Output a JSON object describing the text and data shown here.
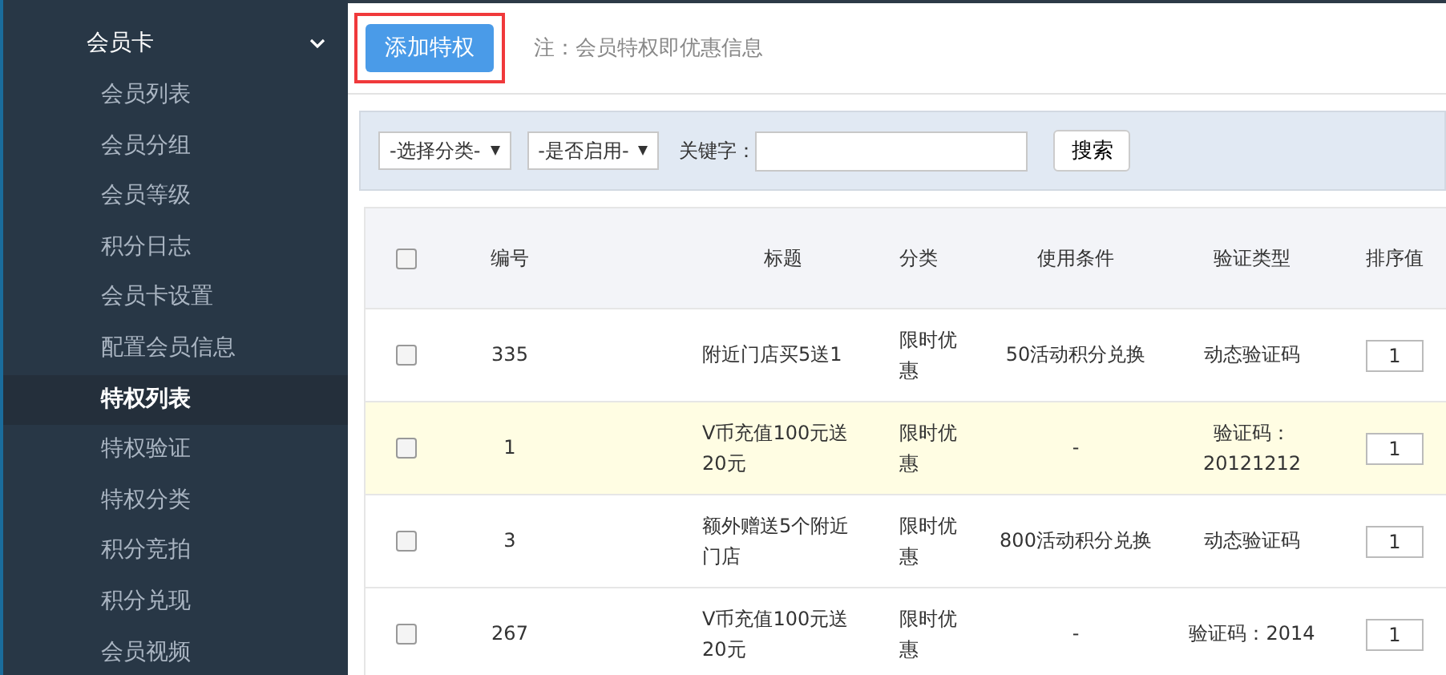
{
  "sidebar": {
    "group": {
      "label": "会员卡",
      "expanded": true
    },
    "items": [
      {
        "label": "会员列表",
        "selected": false
      },
      {
        "label": "会员分组",
        "selected": false
      },
      {
        "label": "会员等级",
        "selected": false
      },
      {
        "label": "积分日志",
        "selected": false
      },
      {
        "label": "会员卡设置",
        "selected": false
      },
      {
        "label": "配置会员信息",
        "selected": false
      },
      {
        "label": "特权列表",
        "selected": true
      },
      {
        "label": "特权验证",
        "selected": false
      },
      {
        "label": "特权分类",
        "selected": false
      },
      {
        "label": "积分竞拍",
        "selected": false
      },
      {
        "label": "积分兑现",
        "selected": false
      },
      {
        "label": "会员视频",
        "selected": false
      }
    ]
  },
  "toolbar": {
    "add_button": "添加特权",
    "note": "注：会员特权即优惠信息"
  },
  "filters": {
    "category": "-选择分类-",
    "enabled": "-是否启用-",
    "keyword_label": "关键字：",
    "search_button": "搜索"
  },
  "table": {
    "all_checked": false,
    "columns": [
      "编号",
      "标题",
      "分类",
      "使用条件",
      "验证类型",
      "排序值"
    ],
    "rows": [
      {
        "checked": false,
        "highlighted": false,
        "cells": [
          "335",
          "附近门店买5送1",
          "限时优惠",
          "50活动积分兑换",
          "动态验证码",
          "1"
        ]
      },
      {
        "checked": false,
        "highlighted": true,
        "cells": [
          "1",
          "V币充值100元送20元",
          "限时优惠",
          "-",
          "验证码：20121212",
          "1"
        ]
      },
      {
        "checked": false,
        "highlighted": false,
        "cells": [
          "3",
          "额外赠送5个附近门店",
          "限时优惠",
          "800活动积分兑换",
          "动态验证码",
          "1"
        ]
      },
      {
        "checked": false,
        "highlighted": false,
        "cells": [
          "267",
          "V币充值100元送20元",
          "限时优惠",
          "-",
          "验证码：2014",
          "1"
        ]
      }
    ]
  }
}
